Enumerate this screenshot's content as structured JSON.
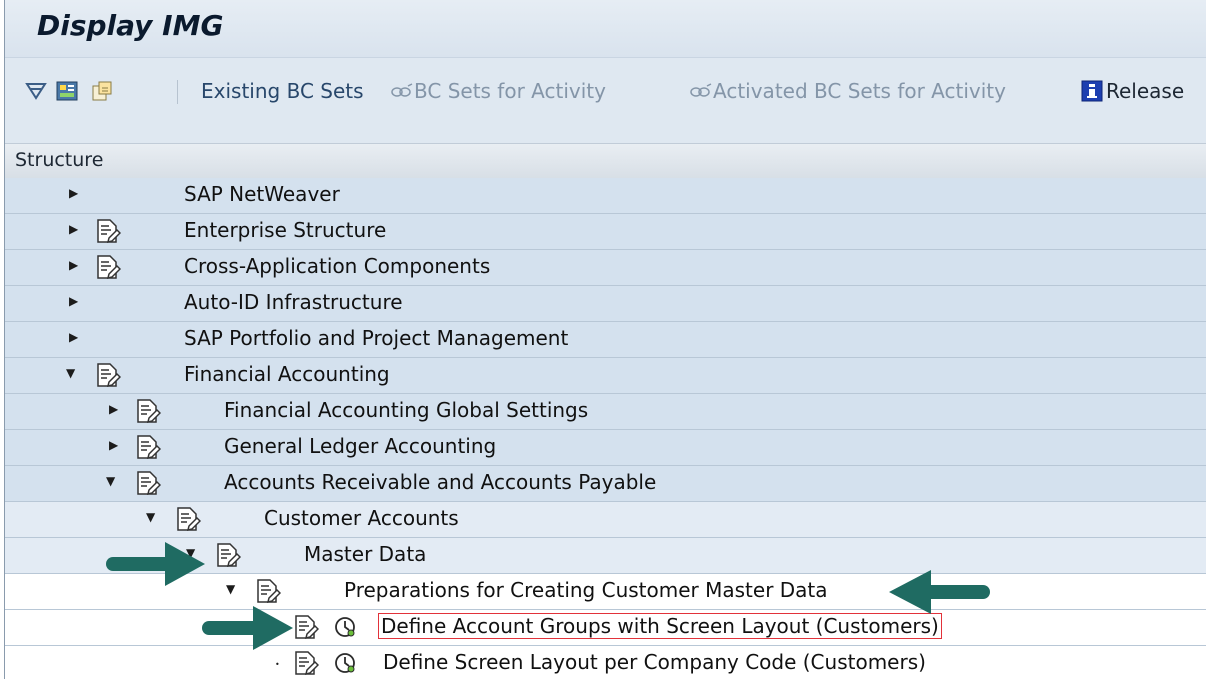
{
  "window": {
    "title": "Display IMG"
  },
  "toolbar": {
    "existing_bc_sets": "Existing BC Sets",
    "bc_sets_for_activity": "BC Sets for Activity",
    "activated_bc_sets": "Activated BC Sets for Activity",
    "release": "Release"
  },
  "tree": {
    "header": "Structure",
    "items": [
      {
        "label": "SAP NetWeaver"
      },
      {
        "label": "Enterprise Structure"
      },
      {
        "label": "Cross-Application Components"
      },
      {
        "label": "Auto-ID Infrastructure"
      },
      {
        "label": "SAP Portfolio and Project Management"
      },
      {
        "label": "Financial Accounting"
      },
      {
        "label": "Financial Accounting Global Settings"
      },
      {
        "label": "General Ledger Accounting"
      },
      {
        "label": "Accounts Receivable and Accounts Payable"
      },
      {
        "label": "Customer Accounts"
      },
      {
        "label": "Master Data"
      },
      {
        "label": "Preparations for Creating Customer Master Data"
      },
      {
        "label": "Define Account Groups with Screen Layout (Customers)"
      },
      {
        "label": "Define Screen Layout per Company Code (Customers)"
      }
    ]
  },
  "colors": {
    "annotation_arrow": "#1f6b62",
    "highlight_box": "#e2323a"
  }
}
